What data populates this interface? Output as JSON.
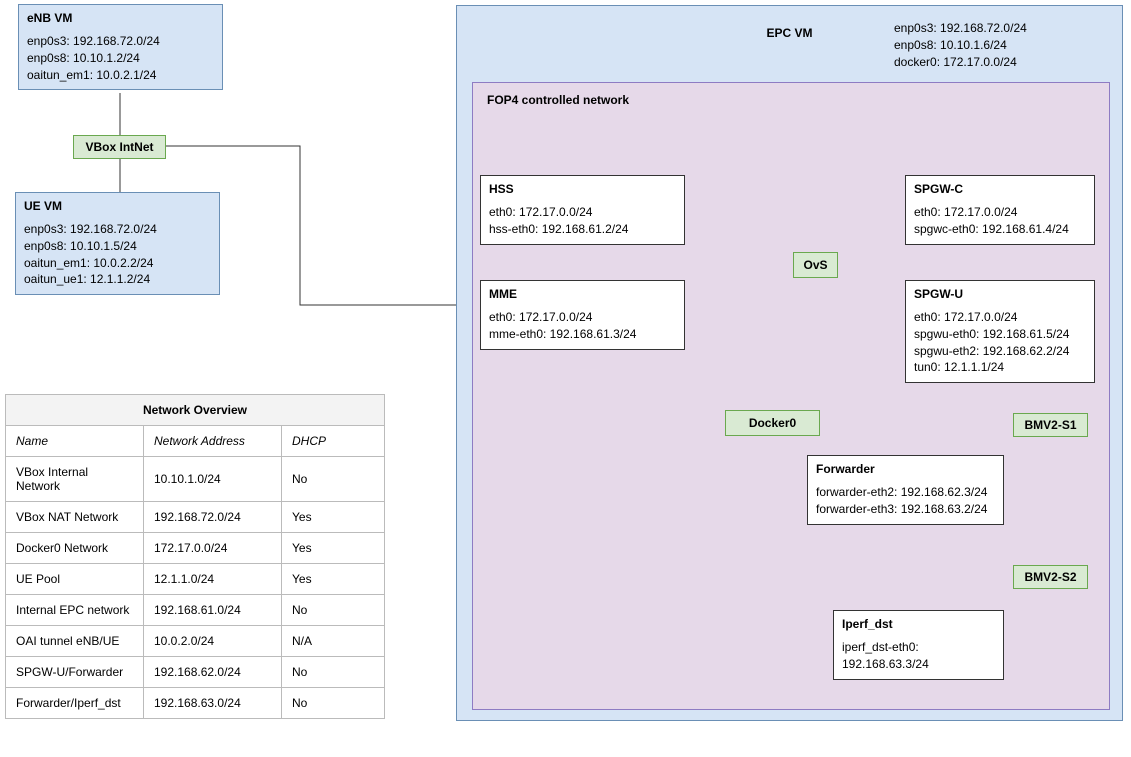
{
  "enb": {
    "title": "eNB VM",
    "l1": "enp0s3: 192.168.72.0/24",
    "l2": "enp0s8: 10.10.1.2/24",
    "l3": "oaitun_em1: 10.0.2.1/24"
  },
  "vbox_intnet": {
    "label": "VBox IntNet"
  },
  "ue": {
    "title": "UE VM",
    "l1": "enp0s3: 192.168.72.0/24",
    "l2": "enp0s8: 10.10.1.5/24",
    "l3": "oaitun_em1: 10.0.2.2/24",
    "l4": "oaitun_ue1: 12.1.1.2/24"
  },
  "epc": {
    "title": "EPC VM",
    "l1": "enp0s3: 192.168.72.0/24",
    "l2": "enp0s8: 10.10.1.6/24",
    "l3": "docker0: 172.17.0.0/24"
  },
  "fop4": {
    "title": "FOP4 controlled network"
  },
  "hss": {
    "title": "HSS",
    "l1": "eth0: 172.17.0.0/24",
    "l2": "hss-eth0: 192.168.61.2/24"
  },
  "mme": {
    "title": "MME",
    "l1": "eth0: 172.17.0.0/24",
    "l2": "mme-eth0: 192.168.61.3/24"
  },
  "spgwc": {
    "title": "SPGW-C",
    "l1": "eth0: 172.17.0.0/24",
    "l2": "spgwc-eth0: 192.168.61.4/24"
  },
  "spgwu": {
    "title": "SPGW-U",
    "l1": "eth0: 172.17.0.0/24",
    "l2": "spgwu-eth0:  192.168.61.5/24",
    "l3": "spgwu-eth2: 192.168.62.2/24",
    "l4": "tun0: 12.1.1.1/24"
  },
  "ovs": {
    "label": "OvS"
  },
  "docker0": {
    "label": "Docker0"
  },
  "bmv2s1": {
    "label": "BMV2-S1"
  },
  "bmv2s2": {
    "label": "BMV2-S2"
  },
  "forwarder": {
    "title": "Forwarder",
    "l1": "forwarder-eth2: 192.168.62.3/24",
    "l2": "forwarder-eth3: 192.168.63.2/24"
  },
  "iperf": {
    "title": "Iperf_dst",
    "l1": "iperf_dst-eth0: 192.168.63.3/24"
  },
  "table": {
    "title": "Network Overview",
    "col_name": "Name",
    "col_addr": "Network Address",
    "col_dhcp": "DHCP",
    "rows": [
      {
        "name": "VBox Internal Network",
        "addr": "10.10.1.0/24",
        "dhcp": "No"
      },
      {
        "name": "VBox NAT Network",
        "addr": "192.168.72.0/24",
        "dhcp": "Yes"
      },
      {
        "name": "Docker0 Network",
        "addr": "172.17.0.0/24",
        "dhcp": "Yes"
      },
      {
        "name": "UE Pool",
        "addr": "12.1.1.0/24",
        "dhcp": "Yes"
      },
      {
        "name": "Internal EPC network",
        "addr": "192.168.61.0/24",
        "dhcp": "No"
      },
      {
        "name": "OAI tunnel eNB/UE",
        "addr": "10.0.2.0/24",
        "dhcp": "N/A"
      },
      {
        "name": "SPGW-U/Forwarder",
        "addr": "192.168.62.0/24",
        "dhcp": "No"
      },
      {
        "name": "Forwarder/Iperf_dst",
        "addr": "192.168.63.0/24",
        "dhcp": "No"
      }
    ]
  }
}
